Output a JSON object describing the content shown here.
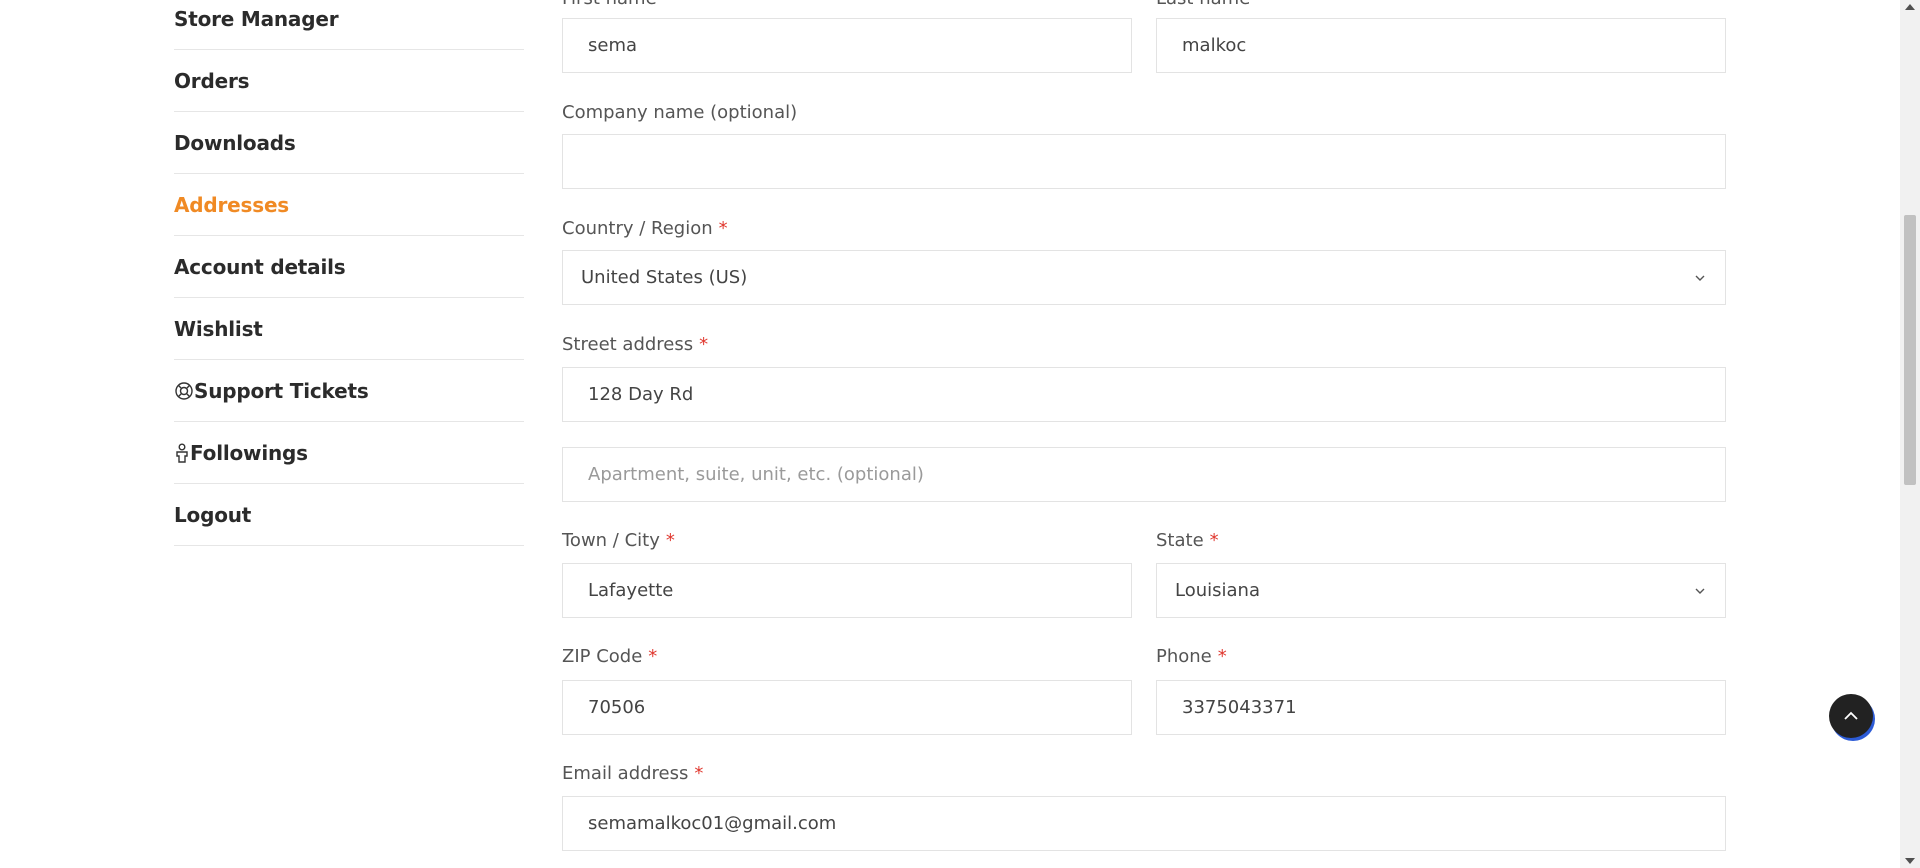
{
  "sidebar": {
    "items": [
      {
        "label": "Store Manager",
        "icon": ""
      },
      {
        "label": "Orders",
        "icon": ""
      },
      {
        "label": "Downloads",
        "icon": ""
      },
      {
        "label": "Addresses",
        "icon": "",
        "active": true
      },
      {
        "label": "Account details",
        "icon": ""
      },
      {
        "label": "Wishlist",
        "icon": ""
      },
      {
        "label": "Support Tickets",
        "icon": "lifebuoy-icon"
      },
      {
        "label": "Followings",
        "icon": "person-icon"
      },
      {
        "label": "Logout",
        "icon": ""
      }
    ],
    "active_color": "#f08a24"
  },
  "form": {
    "first_name": {
      "label": "First name",
      "value": "sema"
    },
    "last_name": {
      "label": "Last name",
      "value": "malkoc"
    },
    "company": {
      "label": "Company name (optional)",
      "value": ""
    },
    "country": {
      "label": "Country / Region",
      "required": "*",
      "value": "United States (US)"
    },
    "street": {
      "label": "Street address",
      "required": "*",
      "value": "128 Day Rd",
      "placeholder2": "Apartment, suite, unit, etc. (optional)"
    },
    "city": {
      "label": "Town / City",
      "required": "*",
      "value": "Lafayette"
    },
    "state": {
      "label": "State",
      "required": "*",
      "value": "Louisiana"
    },
    "zip": {
      "label": "ZIP Code",
      "required": "*",
      "value": "70506"
    },
    "phone": {
      "label": "Phone",
      "required": "*",
      "value": "3375043371"
    },
    "email": {
      "label": "Email address",
      "required": "*",
      "value": "semamalkoc01@gmail.com"
    }
  },
  "colors": {
    "required": "#e0382f",
    "accent": "#f08a24",
    "back_to_top": "#222222"
  },
  "icons": {
    "back_to_top": "chevron-up-icon",
    "select": "chevron-down-icon"
  }
}
